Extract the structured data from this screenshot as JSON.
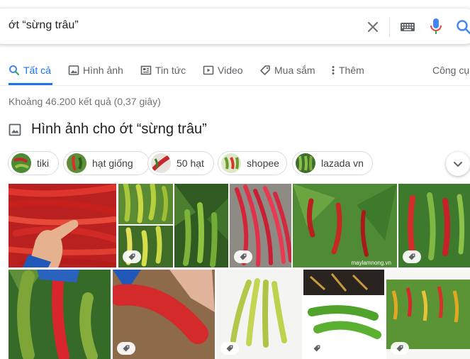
{
  "search": {
    "query": "ớt “sừng trâu”"
  },
  "tabs": [
    {
      "label": "Tất cả",
      "icon": "search-icon"
    },
    {
      "label": "Hình ảnh",
      "icon": "image-icon"
    },
    {
      "label": "Tin tức",
      "icon": "news-icon"
    },
    {
      "label": "Video",
      "icon": "play-icon"
    },
    {
      "label": "Mua sắm",
      "icon": "tag-icon"
    },
    {
      "label": "Thêm",
      "icon": "more-vert-icon"
    }
  ],
  "tools": "Công cụ",
  "stats": "Khoảng 46.200 kết quả (0,37 giây)",
  "images_heading": "Hình ảnh cho ớt “sừng trâu”",
  "chips": [
    {
      "label": "tiki"
    },
    {
      "label": "hạt giống"
    },
    {
      "label": "50 hạt"
    },
    {
      "label": "shopee"
    },
    {
      "label": "lazada vn"
    }
  ],
  "watermark": "maylamnong.vn",
  "colors": {
    "accent": "#1a73e8",
    "pepper_red": "#d0242a",
    "pepper_green": "#6aa02a",
    "leaf": "#3f7a2a"
  }
}
